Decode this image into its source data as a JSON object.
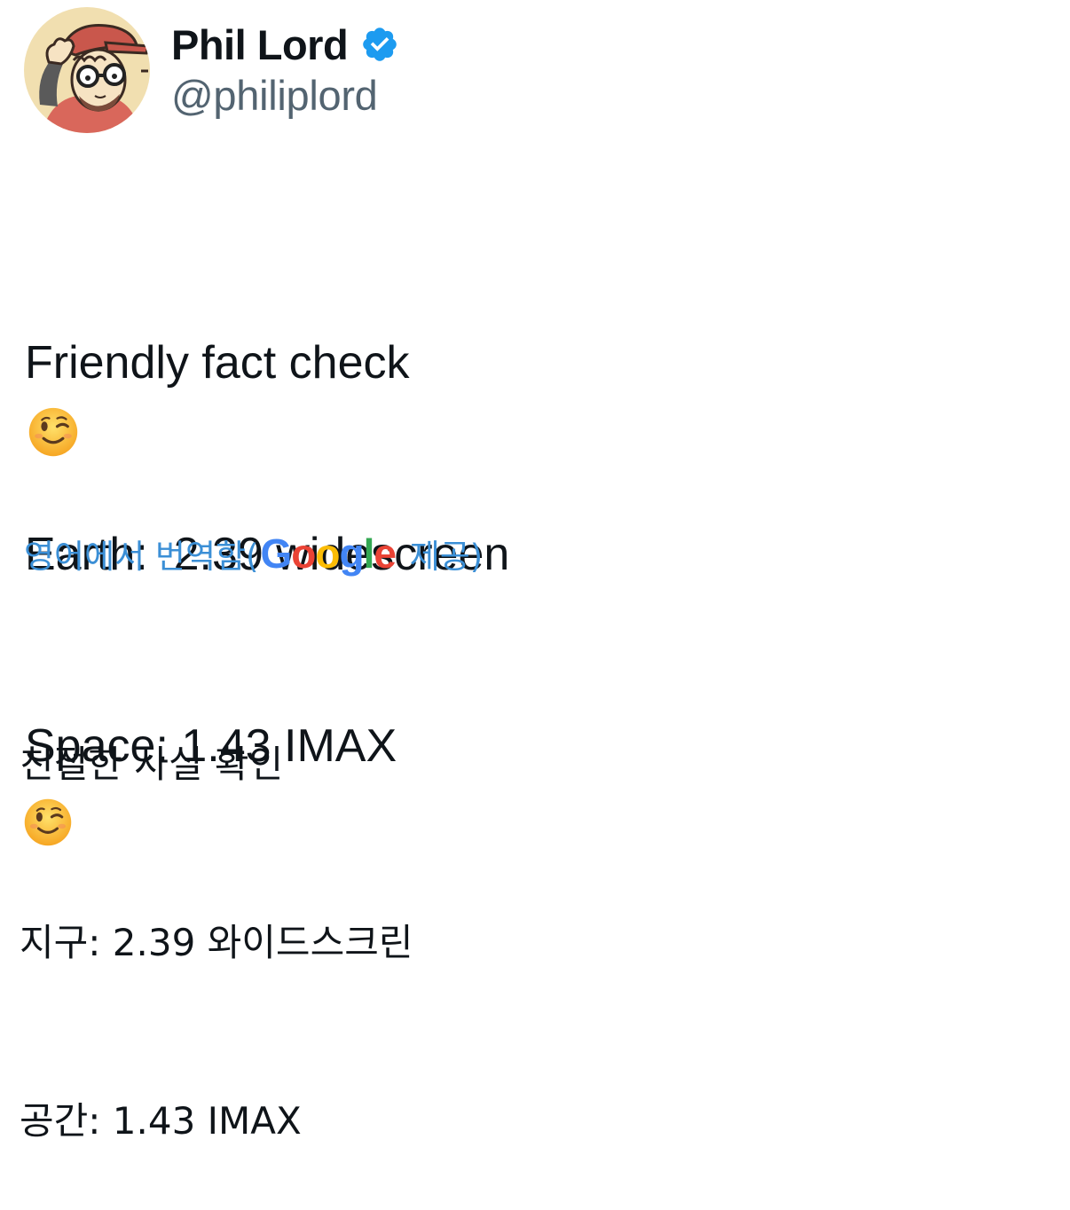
{
  "author": {
    "display_name": "Phil Lord",
    "handle": "@philiplord",
    "verified": true,
    "avatar_icon": "cartoon-avatar",
    "verified_color": "#1d9bf0"
  },
  "tweet": {
    "lines": [
      "Friendly fact check",
      "Earth:  2.39 widescreen",
      "Space: 1.43 IMAX"
    ],
    "emoji": "winking-face"
  },
  "translation": {
    "prefix": "영어에서 번역함(",
    "provider_logo": "Google",
    "suffix": " 제공)",
    "link_color": "#3b8fd6",
    "lines": [
      "친절한 사실 확인",
      "지구: 2.39 와이드스크린",
      "공간: 1.43 IMAX"
    ],
    "emoji": "winking-face"
  }
}
